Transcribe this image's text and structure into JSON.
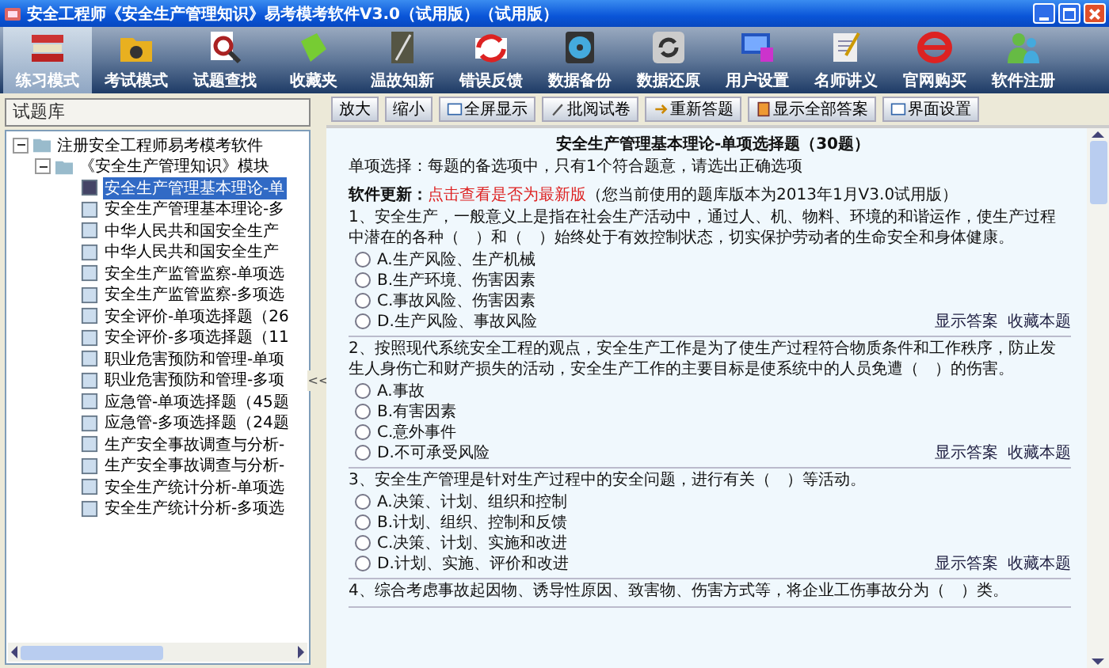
{
  "window": {
    "title": "安全工程师《安全生产管理知识》易考模考软件V3.0（试用版）（试用版）"
  },
  "toolbar": [
    {
      "label": "练习模式",
      "selected": true
    },
    {
      "label": "考试模式",
      "selected": false
    },
    {
      "label": "试题查找",
      "selected": false
    },
    {
      "label": "收藏夹",
      "selected": false
    },
    {
      "label": "温故知新",
      "selected": false
    },
    {
      "label": "错误反馈",
      "selected": false
    },
    {
      "label": "数据备份",
      "selected": false
    },
    {
      "label": "数据还原",
      "selected": false
    },
    {
      "label": "用户设置",
      "selected": false
    },
    {
      "label": "名师讲义",
      "selected": false
    },
    {
      "label": "官网购买",
      "selected": false
    },
    {
      "label": "软件注册",
      "selected": false
    }
  ],
  "sidebar": {
    "title": "试题库",
    "collapse": "<<",
    "tree": {
      "label": "注册安全工程师易考模考软件",
      "expanded": true,
      "children": [
        {
          "label": "《安全生产管理知识》模块",
          "expanded": true,
          "children": [
            {
              "label": "安全生产管理基本理论-单",
              "selected": true
            },
            {
              "label": "安全生产管理基本理论-多",
              "selected": false
            },
            {
              "label": "中华人民共和国安全生产",
              "selected": false
            },
            {
              "label": "中华人民共和国安全生产",
              "selected": false
            },
            {
              "label": "安全生产监管监察-单项选",
              "selected": false
            },
            {
              "label": "安全生产监管监察-多项选",
              "selected": false
            },
            {
              "label": "安全评价-单项选择题（26",
              "selected": false
            },
            {
              "label": "安全评价-多项选择题（11",
              "selected": false
            },
            {
              "label": "职业危害预防和管理-单项",
              "selected": false
            },
            {
              "label": "职业危害预防和管理-多项",
              "selected": false
            },
            {
              "label": "应急管-单项选择题（45题",
              "selected": false
            },
            {
              "label": "应急管-多项选择题（24题",
              "selected": false
            },
            {
              "label": "生产安全事故调查与分析-",
              "selected": false
            },
            {
              "label": "生产安全事故调查与分析-",
              "selected": false
            },
            {
              "label": "安全生产统计分析-单项选",
              "selected": false
            },
            {
              "label": "安全生产统计分析-多项选",
              "selected": false
            }
          ]
        }
      ]
    }
  },
  "actions": [
    {
      "label": "放大",
      "kind": "plain"
    },
    {
      "label": "缩小",
      "kind": "plain"
    },
    {
      "label": "全屏显示",
      "kind": "screen"
    },
    {
      "label": "批阅试卷",
      "kind": "pen"
    },
    {
      "label": "重新答题",
      "kind": "redo"
    },
    {
      "label": "显示全部答案",
      "kind": "answers"
    },
    {
      "label": "界面设置",
      "kind": "window"
    }
  ],
  "exam": {
    "title": "安全生产管理基本理论-单项选择题（30题）",
    "instruction": "单项选择：每题的备选项中，只有1个符合题意，请选出正确选项",
    "update": {
      "label": "软件更新：",
      "link": "点击查看是否为最新版",
      "note": "（您当前使用的题库版本为2013年1月V3.0试用版）"
    },
    "questions": [
      {
        "text": "1、安全生产，一般意义上是指在社会生产活动中，通过人、机、物料、环境的和谐运作，使生产过程中潜在的各种（　）和（　）始终处于有效控制状态，切实保护劳动者的生命安全和身体健康。",
        "options": [
          {
            "label": "A.生产风险、生产机械",
            "selected": false
          },
          {
            "label": "B.生产环境、伤害因素",
            "selected": false
          },
          {
            "label": "C.事故风险、伤害因素",
            "selected": false
          },
          {
            "label": "D.生产风险、事故风险",
            "selected": false
          }
        ],
        "links": [
          "显示答案",
          "收藏本题"
        ]
      },
      {
        "text": "2、按照现代系统安全工程的观点，安全生产工作是为了使生产过程符合物质条件和工作秩序，防止发生人身伤亡和财产损失的活动，安全生产工作的主要目标是使系统中的人员免遭（　）的伤害。",
        "options": [
          {
            "label": "A.事故",
            "selected": false
          },
          {
            "label": "B.有害因素",
            "selected": false
          },
          {
            "label": "C.意外事件",
            "selected": false
          },
          {
            "label": "D.不可承受风险",
            "selected": false
          }
        ],
        "links": [
          "显示答案",
          "收藏本题"
        ]
      },
      {
        "text": "3、安全生产管理是针对生产过程中的安全问题，进行有关（　）等活动。",
        "options": [
          {
            "label": "A.决策、计划、组织和控制",
            "selected": false
          },
          {
            "label": "B.计划、组织、控制和反馈",
            "selected": false
          },
          {
            "label": "C.决策、计划、实施和改进",
            "selected": false
          },
          {
            "label": "D.计划、实施、评价和改进",
            "selected": false
          }
        ],
        "links": [
          "显示答案",
          "收藏本题"
        ]
      },
      {
        "text": "4、综合考虑事故起因物、诱导性原因、致害物、伤害方式等，将企业工伤事故分为（　）类。"
      }
    ]
  }
}
